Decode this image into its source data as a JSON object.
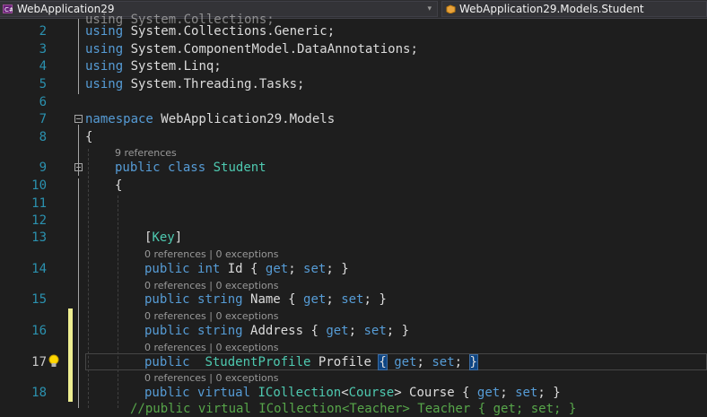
{
  "navigation_bar": {
    "project_combo": "WebApplication29",
    "type_combo": "WebApplication29.Models.Student",
    "dropdown_glyph": "▾"
  },
  "editor": {
    "lines": [
      {
        "num": "",
        "code": "using System.Collections;"
      },
      {
        "num": "2",
        "code": "using System.Collections.Generic;"
      },
      {
        "num": "3",
        "code": "using System.ComponentModel.DataAnnotations;"
      },
      {
        "num": "4",
        "code": "using System.Linq;"
      },
      {
        "num": "5",
        "code": "using System.Threading.Tasks;"
      },
      {
        "num": "6",
        "code": ""
      },
      {
        "num": "7",
        "code": "namespace WebApplication29.Models"
      },
      {
        "num": "8",
        "code": "{"
      },
      {
        "num": "9",
        "code": "public class Student"
      },
      {
        "num": "10",
        "code": "{"
      },
      {
        "num": "11",
        "code": ""
      },
      {
        "num": "12",
        "code": ""
      },
      {
        "num": "13",
        "code": "[Key]"
      },
      {
        "num": "14",
        "code": "public int Id { get; set; }"
      },
      {
        "num": "15",
        "code": "public string Name { get; set; }"
      },
      {
        "num": "16",
        "code": "public string Address { get; set; }"
      },
      {
        "num": "17",
        "code": "public  StudentProfile Profile { get; set; }"
      },
      {
        "num": "18",
        "code": "public virtual ICollection<Course> Course { get; set; }"
      },
      {
        "num": "",
        "code": "//public virtual ICollection<Teacher> Teacher { get; set; }"
      }
    ],
    "codelens": {
      "class_refs": "9 references",
      "member_refs": "0 references | 0 exceptions"
    },
    "current_line": "17"
  },
  "colors": {
    "background": "#1e1e1e",
    "keyword": "#569cd6",
    "type": "#4ec9b0",
    "line_number": "#2b91af",
    "text": "#dcdcdc",
    "comment": "#57a64a",
    "change_marker": "#efef91"
  },
  "icons": [
    "csharp-project-icon",
    "class-icon",
    "collapse-icon",
    "lightbulb-icon"
  ]
}
